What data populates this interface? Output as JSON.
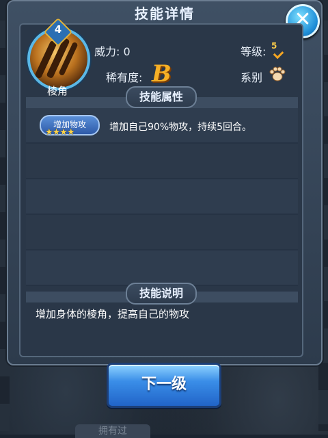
{
  "dialog": {
    "title": "技能详情",
    "close_icon": "close-icon"
  },
  "skill": {
    "name": "棱角",
    "level": "4",
    "power_label": "威力: 0",
    "grade_label": "等级:",
    "grade_value": "5",
    "rarity_label": "稀有度:",
    "rarity_value": "B",
    "series_label": "系别",
    "series_icon": "paw-icon"
  },
  "attributes": {
    "header": "技能属性",
    "items": [
      {
        "tag": "增加物攻",
        "stars": "★★★★",
        "description": "增加自己90%物攻，持续5回合。"
      }
    ]
  },
  "description": {
    "header": "技能说明",
    "text": "增加身体的棱角，提高自己的物攻"
  },
  "buttons": {
    "next_level": "下一级"
  },
  "background": {
    "bottom_tab": "拥有过"
  }
}
